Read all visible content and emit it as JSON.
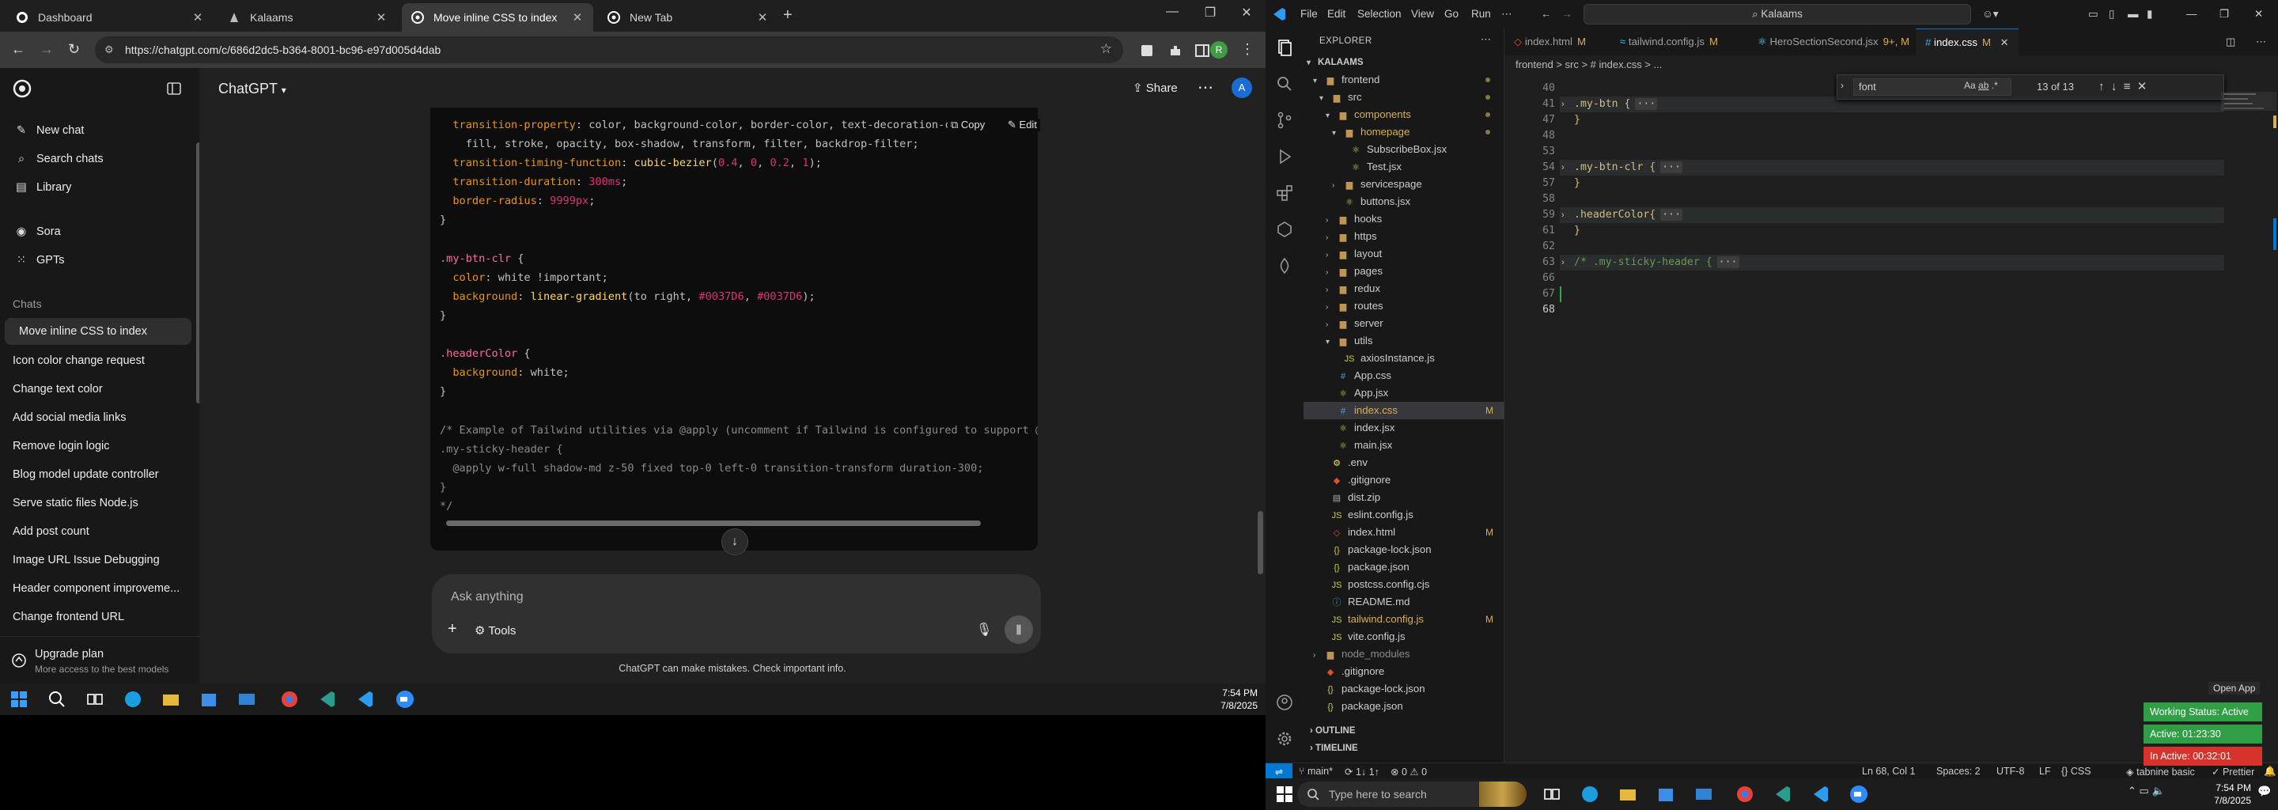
{
  "browser": {
    "tabs": [
      {
        "label": "Dashboard",
        "active": false
      },
      {
        "label": "Kalaams",
        "active": false
      },
      {
        "label": "Move inline CSS to index",
        "active": true
      },
      {
        "label": "New Tab",
        "active": false
      }
    ],
    "url": "https://chatgpt.com/c/686d2dc5-b364-8001-bc96-e97d005d4dab",
    "profile_initial": "A"
  },
  "sidebar": {
    "top_items": [
      {
        "label": "New chat",
        "icon": "compose-icon"
      },
      {
        "label": "Search chats",
        "icon": "search-icon"
      },
      {
        "label": "Library",
        "icon": "library-icon"
      }
    ],
    "mid_items": [
      {
        "label": "Sora",
        "icon": "sora-icon"
      },
      {
        "label": "GPTs",
        "icon": "gpts-icon"
      }
    ],
    "chats_label": "Chats",
    "chats": [
      "Move inline CSS to index",
      "Icon color change request",
      "Change text color",
      "Add social media links",
      "Remove login logic",
      "Blog model update controller",
      "Serve static files Node.js",
      "Add post count",
      "Image URL Issue Debugging",
      "Header component improveme...",
      "Change frontend URL"
    ],
    "upgrade_title": "Upgrade plan",
    "upgrade_sub": "More access to the best models"
  },
  "chat": {
    "model": "ChatGPT",
    "share_label": "Share",
    "copy_label": "Copy",
    "edit_label": "Edit",
    "composer_placeholder": "Ask anything",
    "tools_label": "Tools",
    "disclaimer": "ChatGPT can make mistakes. Check important info.",
    "code_lines": [
      "  transition-property: color, background-color, border-color, text-decoration-color",
      "    fill, stroke, opacity, box-shadow, transform, filter, backdrop-filter;",
      "  transition-timing-function: cubic-bezier(0.4, 0, 0.2, 1);",
      "  transition-duration: 300ms;",
      "  border-radius: 9999px;",
      "}",
      "",
      ".my-btn-clr {",
      "  color: white !important;",
      "  background: linear-gradient(to right, #0037D6, #0037D6);",
      "}",
      "",
      ".headerColor {",
      "  background: white;",
      "}",
      "",
      "/* Example of Tailwind utilities via @apply (uncomment if Tailwind is configured to support @apply",
      ".my-sticky-header {",
      "  @apply w-full shadow-md z-50 fixed top-0 left-0 transition-transform duration-300;",
      "}",
      "*/"
    ]
  },
  "taskbar_left": {
    "time": "7:54 PM",
    "date": "7/8/2025"
  },
  "vscode": {
    "menu": [
      "File",
      "Edit",
      "Selection",
      "View",
      "Go",
      "Run"
    ],
    "search": "Kalaams",
    "explorer_title": "EXPLORER",
    "root": "KALAAMS",
    "tree": [
      {
        "label": "frontend",
        "type": "folder",
        "depth": 0,
        "open": true,
        "dot": true
      },
      {
        "label": "src",
        "type": "folder",
        "depth": 1,
        "open": true,
        "dot": true
      },
      {
        "label": "components",
        "type": "folder",
        "depth": 2,
        "open": true,
        "dot": true,
        "color": "#d7b04f"
      },
      {
        "label": "homepage",
        "type": "folder",
        "depth": 3,
        "open": true,
        "dot": true,
        "color": "#d7b04f"
      },
      {
        "label": "SubscribeBox.jsx",
        "type": "jsx",
        "depth": 4
      },
      {
        "label": "Test.jsx",
        "type": "jsx",
        "depth": 4
      },
      {
        "label": "servicespage",
        "type": "folder",
        "depth": 3,
        "open": false
      },
      {
        "label": "buttons.jsx",
        "type": "jsx",
        "depth": 3
      },
      {
        "label": "hooks",
        "type": "folder",
        "depth": 2,
        "open": false
      },
      {
        "label": "https",
        "type": "folder",
        "depth": 2,
        "open": false
      },
      {
        "label": "layout",
        "type": "folder",
        "depth": 2,
        "open": false
      },
      {
        "label": "pages",
        "type": "folder",
        "depth": 2,
        "open": false
      },
      {
        "label": "redux",
        "type": "folder",
        "depth": 2,
        "open": false
      },
      {
        "label": "routes",
        "type": "folder",
        "depth": 2,
        "open": false
      },
      {
        "label": "server",
        "type": "folder",
        "depth": 2,
        "open": false
      },
      {
        "label": "utils",
        "type": "folder",
        "depth": 2,
        "open": true
      },
      {
        "label": "axiosInstance.js",
        "type": "js",
        "depth": 3
      },
      {
        "label": "App.css",
        "type": "css",
        "depth": 2
      },
      {
        "label": "App.jsx",
        "type": "jsx",
        "depth": 2
      },
      {
        "label": "index.css",
        "type": "css",
        "depth": 2,
        "selected": true,
        "mark": "M",
        "color": "#d7b04f"
      },
      {
        "label": "index.jsx",
        "type": "jsx",
        "depth": 2
      },
      {
        "label": "main.jsx",
        "type": "jsx",
        "depth": 2
      },
      {
        "label": ".env",
        "type": "env",
        "depth": 1
      },
      {
        "label": ".gitignore",
        "type": "git",
        "depth": 1
      },
      {
        "label": "dist.zip",
        "type": "zip",
        "depth": 1
      },
      {
        "label": "eslint.config.js",
        "type": "js",
        "depth": 1
      },
      {
        "label": "index.html",
        "type": "html",
        "depth": 1,
        "mark": "M"
      },
      {
        "label": "package-lock.json",
        "type": "json",
        "depth": 1
      },
      {
        "label": "package.json",
        "type": "json",
        "depth": 1
      },
      {
        "label": "postcss.config.cjs",
        "type": "js",
        "depth": 1
      },
      {
        "label": "README.md",
        "type": "md",
        "depth": 1
      },
      {
        "label": "tailwind.config.js",
        "type": "js",
        "depth": 1,
        "mark": "M",
        "color": "#d7b04f"
      },
      {
        "label": "vite.config.js",
        "type": "js",
        "depth": 1
      },
      {
        "label": "node_modules",
        "type": "folder",
        "depth": 0,
        "open": false,
        "color": "#8c8c8c"
      },
      {
        "label": ".gitignore",
        "type": "git",
        "depth": 0
      },
      {
        "label": "package-lock.json",
        "type": "json",
        "depth": 0
      },
      {
        "label": "package.json",
        "type": "json",
        "depth": 0
      }
    ],
    "outline_label": "OUTLINE",
    "timeline_label": "TIMELINE",
    "editor_tabs": [
      {
        "label": "index.html",
        "mark": "M"
      },
      {
        "label": "tailwind.config.js",
        "mark": "M"
      },
      {
        "label": "HeroSectionSecond.jsx",
        "mark": "9+, M"
      },
      {
        "label": "index.css",
        "mark": "M",
        "active": true
      }
    ],
    "breadcrumb": "frontend > src > # index.css > ...",
    "find_text": "font",
    "find_result": "13 of 13",
    "lines": [
      {
        "n": "40",
        "text": ""
      },
      {
        "n": "41",
        "text": ".my-btn {",
        "fold": true
      },
      {
        "n": "47",
        "text": "}"
      },
      {
        "n": "48",
        "text": ""
      },
      {
        "n": "53",
        "text": ""
      },
      {
        "n": "54",
        "text": ".my-btn-clr {",
        "fold": true
      },
      {
        "n": "57",
        "text": "}"
      },
      {
        "n": "58",
        "text": ""
      },
      {
        "n": "59",
        "text": ".headerColor{",
        "fold": true
      },
      {
        "n": "61",
        "text": "}"
      },
      {
        "n": "62",
        "text": ""
      },
      {
        "n": "63",
        "text": "/* .my-sticky-header {",
        "fold": true,
        "comment": true
      },
      {
        "n": "66",
        "text": ""
      },
      {
        "n": "67",
        "text": ""
      },
      {
        "n": "68",
        "text": ""
      }
    ],
    "status": {
      "branch": "main*",
      "sync": "1↓ 1↑",
      "problems": "0 ⚠ 0",
      "position": "Ln 68, Col 1",
      "spaces": "Spaces: 2",
      "encoding": "UTF-8",
      "eol": "LF",
      "language": "CSS",
      "tabnine": "tabnine basic",
      "prettier": "Prettier"
    },
    "open_app": "Open App",
    "working_status": "Working Status: Active",
    "active_time": "Active: 01:23:30",
    "inactive_time": "In Active: 00:32:01"
  },
  "taskbar_right": {
    "search_placeholder": "Type here to search",
    "time": "7:54 PM",
    "date": "7/8/2025"
  }
}
